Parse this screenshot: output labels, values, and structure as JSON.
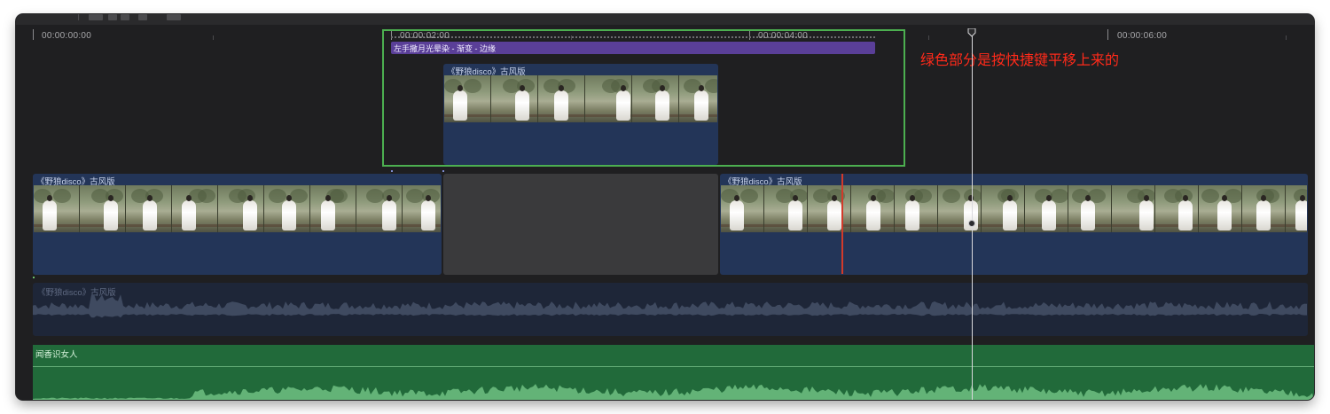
{
  "timeline": {
    "ruler": {
      "timecodes": [
        "00:00:00:00",
        "00:00:02:00",
        "00:00:04:00",
        "00:00:06:00"
      ]
    },
    "title_effect": {
      "label": "左手撒月光晕染 - 渐变 - 边缘",
      "color": "#5a3f98"
    },
    "upper_clip": {
      "label": "《野狼disco》古风版"
    },
    "primary_clips": [
      {
        "label": "《野狼disco》古风版"
      },
      {
        "label": "《野狼disco》古风版"
      }
    ],
    "audio_track": {
      "label": "《野狼disco》古风版"
    },
    "music_track": {
      "label": "闻香识女人",
      "color": "#216a3a"
    },
    "annotation": {
      "text": "绿色部分是按快捷键平移上来的",
      "color": "#ff2a1a"
    },
    "highlight_color": "#4caf50",
    "clip_color": "#233558"
  }
}
